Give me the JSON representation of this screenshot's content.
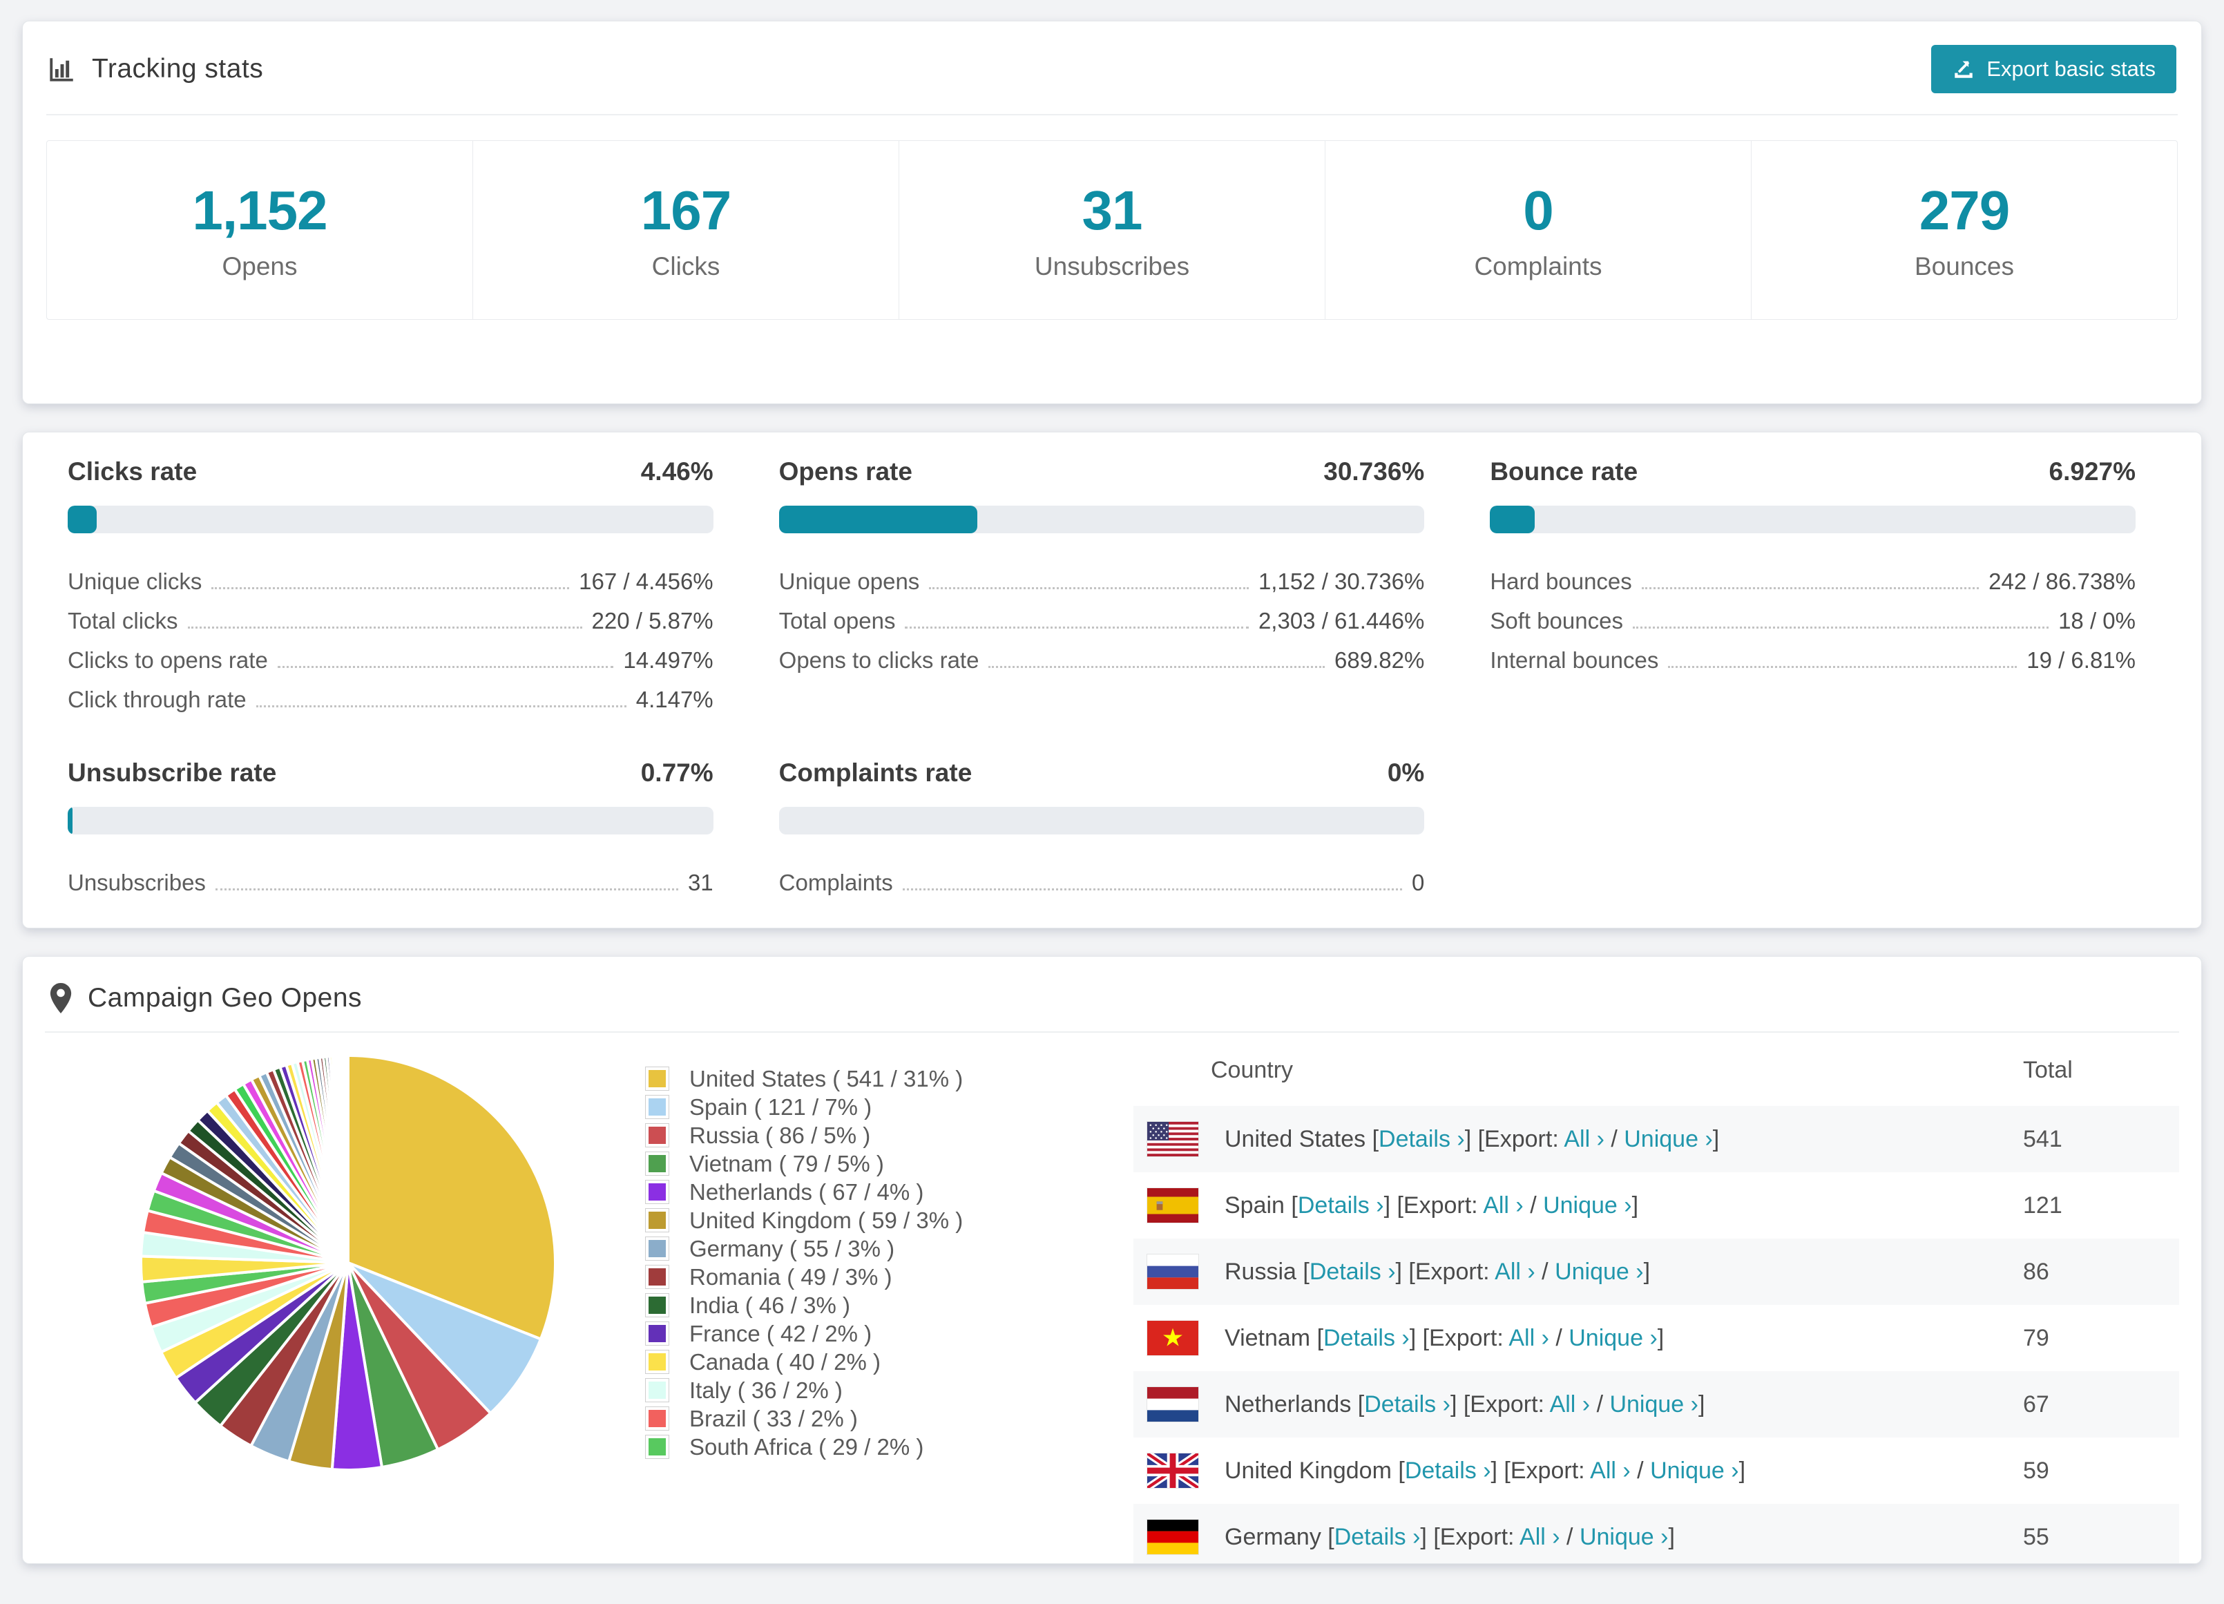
{
  "colors": {
    "accent": "#0f8da4",
    "button": "#1b93a9",
    "link": "#2196ac",
    "bar_track": "#e9ecf0",
    "row_shade": "#f7f8f9"
  },
  "tracking": {
    "title": "Tracking stats",
    "export_label": "Export basic stats",
    "stats": [
      {
        "value": "1,152",
        "label": "Opens"
      },
      {
        "value": "167",
        "label": "Clicks"
      },
      {
        "value": "31",
        "label": "Unsubscribes"
      },
      {
        "value": "0",
        "label": "Complaints"
      },
      {
        "value": "279",
        "label": "Bounces"
      }
    ]
  },
  "rates": [
    {
      "title": "Clicks rate",
      "value": "4.46%",
      "percent": 4.46,
      "rows": [
        {
          "label": "Unique clicks",
          "value": "167 / 4.456%"
        },
        {
          "label": "Total clicks",
          "value": "220 / 5.87%"
        },
        {
          "label": "Clicks to opens rate",
          "value": "14.497%"
        },
        {
          "label": "Click through rate",
          "value": "4.147%"
        }
      ]
    },
    {
      "title": "Opens rate",
      "value": "30.736%",
      "percent": 30.736,
      "rows": [
        {
          "label": "Unique opens",
          "value": "1,152 / 30.736%"
        },
        {
          "label": "Total opens",
          "value": "2,303 / 61.446%"
        },
        {
          "label": "Opens to clicks rate",
          "value": "689.82%"
        }
      ]
    },
    {
      "title": "Bounce rate",
      "value": "6.927%",
      "percent": 6.927,
      "rows": [
        {
          "label": "Hard bounces",
          "value": "242 / 86.738%"
        },
        {
          "label": "Soft bounces",
          "value": "18 / 0%"
        },
        {
          "label": "Internal bounces",
          "value": "19 / 6.81%"
        }
      ]
    },
    {
      "title": "Unsubscribe rate",
      "value": "0.77%",
      "percent": 0.77,
      "rows": [
        {
          "label": "Unsubscribes",
          "value": "31"
        }
      ]
    },
    {
      "title": "Complaints rate",
      "value": "0%",
      "percent": 0,
      "rows": [
        {
          "label": "Complaints",
          "value": "0"
        }
      ]
    }
  ],
  "geo": {
    "title": "Campaign Geo Opens",
    "table": {
      "headers": [
        "Country",
        "Total"
      ],
      "links": {
        "details": "Details",
        "export_prefix": "Export:",
        "all": "All",
        "unique": "Unique",
        "arrow": "›",
        "lb": "[",
        "rb": "]",
        "sep": "/"
      },
      "rows": [
        {
          "flag": "us",
          "country": "United States",
          "total": "541"
        },
        {
          "flag": "es",
          "country": "Spain",
          "total": "121"
        },
        {
          "flag": "ru",
          "country": "Russia",
          "total": "86"
        },
        {
          "flag": "vn",
          "country": "Vietnam",
          "total": "79"
        },
        {
          "flag": "nl",
          "country": "Netherlands",
          "total": "67"
        },
        {
          "flag": "gb",
          "country": "United Kingdom",
          "total": "59"
        },
        {
          "flag": "de",
          "country": "Germany",
          "total": "55"
        }
      ]
    },
    "chart_data": {
      "type": "pie",
      "title": "Campaign Geo Opens",
      "legend_position": "right",
      "start_angle_deg": -90,
      "direction": "clockwise",
      "series": [
        {
          "name": "United States",
          "value": 541,
          "pct": 31,
          "color": "#e8c33f"
        },
        {
          "name": "Spain",
          "value": 121,
          "pct": 7,
          "color": "#abd3f1"
        },
        {
          "name": "Russia",
          "value": 86,
          "pct": 5,
          "color": "#cc4e52"
        },
        {
          "name": "Vietnam",
          "value": 79,
          "pct": 5,
          "color": "#4fa04f"
        },
        {
          "name": "Netherlands",
          "value": 67,
          "pct": 4,
          "color": "#8b2fe3"
        },
        {
          "name": "United Kingdom",
          "value": 59,
          "pct": 3,
          "color": "#bd9b30"
        },
        {
          "name": "Germany",
          "value": 55,
          "pct": 3,
          "color": "#8badca"
        },
        {
          "name": "Romania",
          "value": 49,
          "pct": 3,
          "color": "#a03c3c"
        },
        {
          "name": "India",
          "value": 46,
          "pct": 3,
          "color": "#2c6b33"
        },
        {
          "name": "France",
          "value": 42,
          "pct": 2,
          "color": "#6330b8"
        },
        {
          "name": "Canada",
          "value": 40,
          "pct": 2,
          "color": "#fbe14b"
        },
        {
          "name": "Italy",
          "value": 36,
          "pct": 2,
          "color": "#dbfdf4"
        },
        {
          "name": "Brazil",
          "value": 33,
          "pct": 2,
          "color": "#f2615e"
        },
        {
          "name": "South Africa",
          "value": 29,
          "pct": 2,
          "color": "#58c95f"
        }
      ],
      "others": {
        "value": 462,
        "slice_count": 38,
        "decay": 0.93,
        "palette": [
          "#f9e04b",
          "#d8fcf3",
          "#f2615e",
          "#58c95f",
          "#d94ae0",
          "#8a7a25",
          "#5d7386",
          "#7e2e2e",
          "#1e5226",
          "#2a2060",
          "#f6ee3e",
          "#a9cde9",
          "#e03e3e",
          "#3fd156",
          "#e44ae4",
          "#bd9b30",
          "#88adca",
          "#9e3d3d",
          "#2c6b33",
          "#6330b8"
        ]
      },
      "legend_item_format": "{name} ( {value} / {pct}% )"
    }
  }
}
